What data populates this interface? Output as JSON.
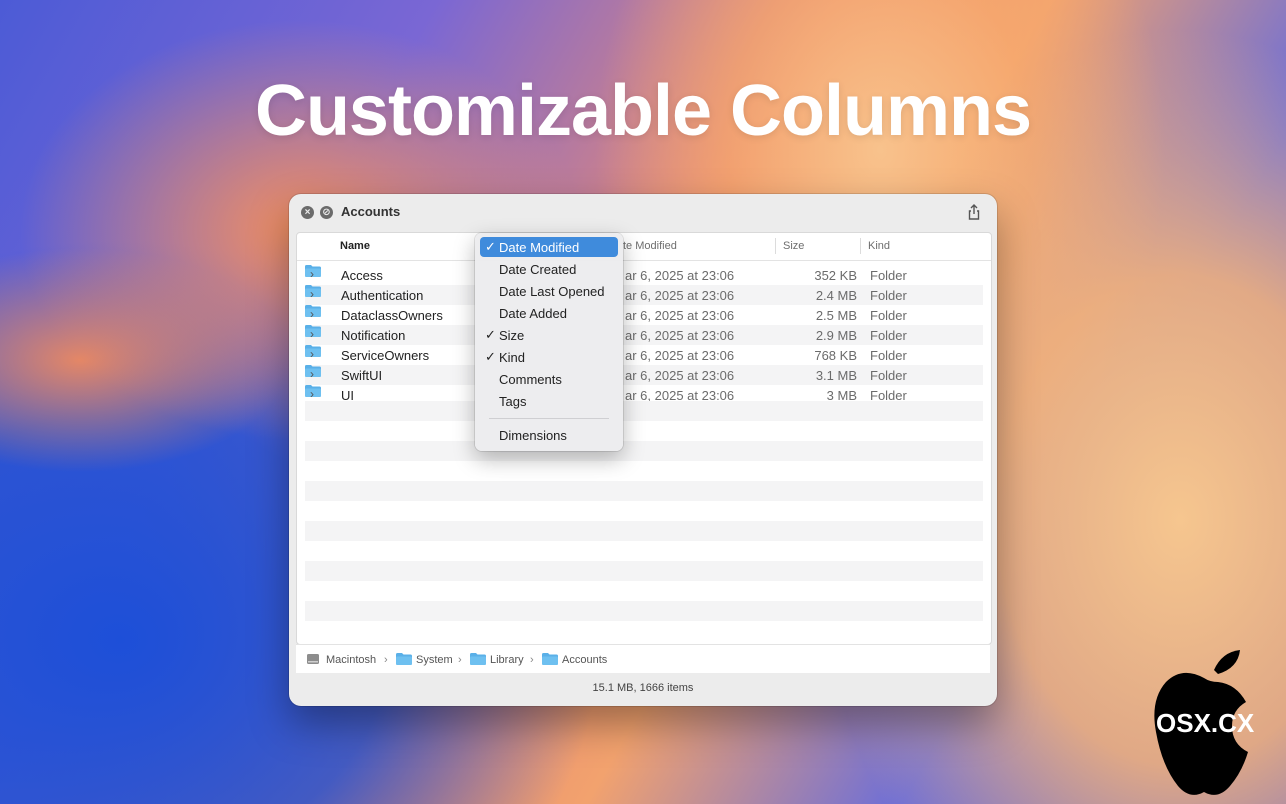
{
  "headline": "Customizable Columns",
  "window": {
    "title": "Accounts",
    "columns": {
      "name": "Name",
      "date_modified_partial": "te Modified",
      "size": "Size",
      "kind": "Kind"
    },
    "rows": [
      {
        "name": "Access",
        "date": "ar 6, 2025 at 23:06",
        "size": "352 KB",
        "kind": "Folder"
      },
      {
        "name": "Authentication",
        "date": "ar 6, 2025 at 23:06",
        "size": "2.4 MB",
        "kind": "Folder"
      },
      {
        "name": "DataclassOwners",
        "date": "ar 6, 2025 at 23:06",
        "size": "2.5 MB",
        "kind": "Folder"
      },
      {
        "name": "Notification",
        "date": "ar 6, 2025 at 23:06",
        "size": "2.9 MB",
        "kind": "Folder"
      },
      {
        "name": "ServiceOwners",
        "date": "ar 6, 2025 at 23:06",
        "size": "768 KB",
        "kind": "Folder"
      },
      {
        "name": "SwiftUI",
        "date": "ar 6, 2025 at 23:06",
        "size": "3.1 MB",
        "kind": "Folder"
      },
      {
        "name": "UI",
        "date": "ar 6, 2025 at 23:06",
        "size": "3 MB",
        "kind": "Folder"
      }
    ],
    "path": [
      "Macintosh",
      "System",
      "Library",
      "Accounts"
    ],
    "path_separator": "›",
    "status": "15.1 MB, 1666 items"
  },
  "column_menu": {
    "items": [
      {
        "label": "Date Modified",
        "checked": true,
        "highlighted": true
      },
      {
        "label": "Date Created",
        "checked": false
      },
      {
        "label": "Date Last Opened",
        "checked": false
      },
      {
        "label": "Date Added",
        "checked": false
      },
      {
        "label": "Size",
        "checked": true
      },
      {
        "label": "Kind",
        "checked": true
      },
      {
        "label": "Comments",
        "checked": false
      },
      {
        "label": "Tags",
        "checked": false
      },
      {
        "label": "Dimensions",
        "checked": false
      }
    ],
    "check_glyph": "✓"
  },
  "watermark": {
    "text": "OSX.CX"
  },
  "colors": {
    "accent": "#3f8bdc",
    "folder": "#5ab0e8"
  },
  "icons": {
    "close": "close-icon",
    "block": "block-icon",
    "share": "share-icon",
    "folder": "folder-icon",
    "disk": "disk-icon",
    "chevron": "chevron-right-icon"
  }
}
